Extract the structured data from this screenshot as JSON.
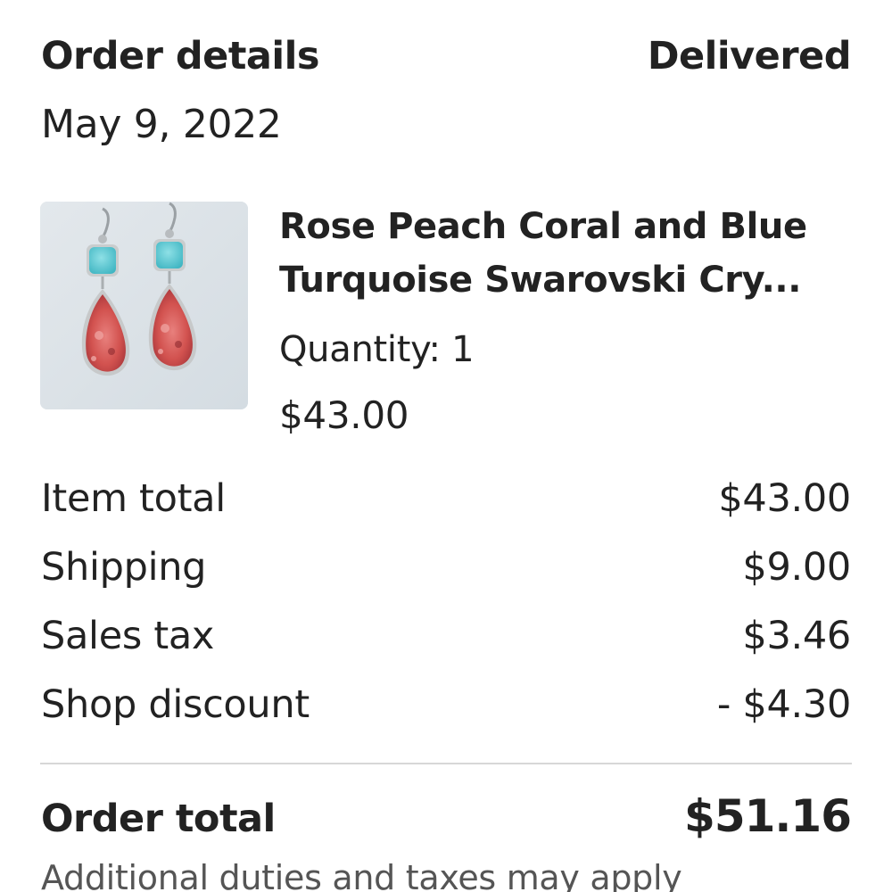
{
  "header": {
    "title": "Order details",
    "status": "Delivered",
    "date": "May 9, 2022"
  },
  "item": {
    "title_line1": "Rose Peach Coral and Blue",
    "title_line2": "Turquoise Swarovski Cry...",
    "quantity": "Quantity: 1",
    "price": "$43.00",
    "image_icon": "earrings-product-image"
  },
  "summary": {
    "rows": [
      {
        "label": "Item total",
        "value": "$43.00"
      },
      {
        "label": "Shipping",
        "value": "$9.00"
      },
      {
        "label": "Sales tax",
        "value": "$3.46"
      },
      {
        "label": "Shop discount",
        "value": "- $4.30"
      }
    ]
  },
  "total": {
    "label": "Order total",
    "value": "$51.16"
  },
  "note": "Additional duties and taxes may apply",
  "colors": {
    "text": "#222222",
    "divider": "#d7d7d7",
    "turquoise": "#5cc7d3",
    "coral": "#d85a5c"
  }
}
